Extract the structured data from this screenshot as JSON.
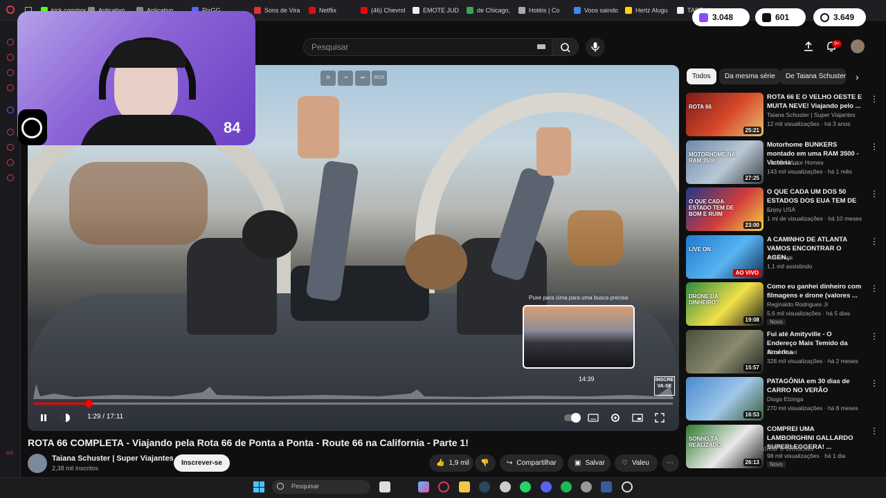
{
  "browser": {
    "bookmarks": [
      {
        "label": "kick.com/pog",
        "color": "#53fc18"
      },
      {
        "label": "Aplicativo",
        "color": "#888"
      },
      {
        "label": "Aplicativo",
        "color": "#888"
      },
      {
        "label": "PixGG",
        "color": "#5865f2"
      },
      {
        "label": "Sons de Vira",
        "color": "#d33"
      },
      {
        "label": "Netflix",
        "color": "#e50914"
      },
      {
        "label": "(46) Chevrol",
        "color": "#ff0000"
      },
      {
        "label": "EMOTE JUD",
        "color": "#eee"
      },
      {
        "label": "de Chicago,",
        "color": "#34a853"
      },
      {
        "label": "Hotéis | Co",
        "color": "#aaa"
      },
      {
        "label": "Voos saindo",
        "color": "#4285f4"
      },
      {
        "label": "Hertz Alugu",
        "color": "#ffd400"
      },
      {
        "label": "TABELA",
        "color": "#eee"
      }
    ]
  },
  "stream_overlay": {
    "score": "84",
    "stats": [
      {
        "value": "3.048",
        "icon": "twitch-viewers-icon",
        "color": "#9146ff"
      },
      {
        "value": "601",
        "icon": "kick-viewers-icon",
        "color": "#111"
      },
      {
        "value": "3.649",
        "icon": "globe-viewers-icon",
        "color": "#111"
      }
    ]
  },
  "header": {
    "search_placeholder": "Pesquisar",
    "notifications_badge": "9+"
  },
  "player": {
    "hint": "Puxe para cima para uma busca precisa",
    "preview_time": "14:39",
    "current_time": "1:29",
    "duration": "17:11",
    "time_display": "1:29 / 17:11",
    "progress_fraction": 0.0863,
    "hover_fraction": 0.852,
    "inscreva_label": "INSCRE VA-SE",
    "top_controls": [
      "copy-icon",
      "enter-icon",
      "skip-icon",
      "RGX"
    ]
  },
  "video": {
    "title": "ROTA 66 COMPLETA - Viajando pela Rota 66 de Ponta a Ponta - Route 66 na California - Parte 1!",
    "channel": "Taiana Schuster | Super Viajantes",
    "subscribers": "2,38 mil inscritos",
    "subscribe_label": "Inscrever-se",
    "likes": "1,9 mil",
    "share_label": "Compartilhar",
    "save_label": "Salvar",
    "thanks_label": "Valeu"
  },
  "chips": [
    "Todos",
    "Da mesma série",
    "De Taiana Schuster | Su"
  ],
  "recommendations": [
    {
      "title": "ROTA 66 E O VELHO OESTE E MUITA NEVE! Viajando pelo ...",
      "channel": "Taiana Schuster | Super Viajantes",
      "meta": "12 mil visualizações · há 3 anos",
      "duration": "25:21",
      "badge": "",
      "thumb_text": "ROTA 66",
      "colors": [
        "#7a1a1a",
        "#d84a2a",
        "#e8c070"
      ]
    },
    {
      "title": "Motorhome BUNKERS montado em uma RAM 3500 - Victória ...",
      "channel": "Victória Motor Homes",
      "meta": "143 mil visualizações · há 1 mês",
      "duration": "27:25",
      "badge": "",
      "thumb_text": "MOTORHOME NA RAM 3500",
      "colors": [
        "#6d8aa8",
        "#b9c8d5",
        "#3a3f46"
      ]
    },
    {
      "title": "O QUE CADA UM DOS 50 ESTADOS DOS EUA TEM DE ...",
      "channel": "Enjoy USA",
      "meta": "1 mi de visualizações · há 10 meses",
      "duration": "23:00",
      "badge": "",
      "thumb_text": "O QUE CADA ESTADO TEM DE BOM E RUIM",
      "colors": [
        "#1d3a8a",
        "#d23b3b",
        "#f2d24a"
      ]
    },
    {
      "title": "A CAMINHO DE ATLANTA VAMOS ENCONTRAR O AGEN...",
      "channel": "Jon Vlogs",
      "meta": "1,1 mil assistindo",
      "duration": "AO VIVO",
      "badge": "live",
      "thumb_text": "LIVE ON",
      "colors": [
        "#1f7ad1",
        "#58b3f0",
        "#0d2d52"
      ]
    },
    {
      "title": "Como eu ganhei dinheiro com filmagens e drone (valores ...",
      "channel": "Reginaldo Rodrigues Jr",
      "meta": "5,6 mil visualizações · há 5 dias",
      "duration": "19:08",
      "badge": "Novo",
      "thumb_text": "DRONE DÁ DINHEIRO?",
      "colors": [
        "#2b8a3e",
        "#f2e14a",
        "#1a1a1a"
      ]
    },
    {
      "title": "Fui até Amityville - O Endereço Mais Temido da América",
      "channel": "Elton Davel",
      "meta": "328 mil visualizações · há 2 meses",
      "duration": "15:57",
      "badge": "",
      "thumb_text": "",
      "colors": [
        "#4a4f3d",
        "#8a8a70",
        "#1f221c"
      ]
    },
    {
      "title": "PATAGÔNIA em 30 dias de CARRO NO VERÃO",
      "channel": "Diogo Elzinga",
      "meta": "270 mil visualizações · há 8 meses",
      "duration": "16:53",
      "badge": "",
      "thumb_text": "",
      "colors": [
        "#4a8ad0",
        "#9fc7e8",
        "#3d5a3a"
      ]
    },
    {
      "title": "COMPREI UMA LAMBORGHINI GALLARDO SUPERLEGGERA! ...",
      "channel": "Tecno Auto",
      "meta": "98 mil visualizações · há 1 dia",
      "duration": "26:13",
      "badge": "Novo",
      "thumb_text": "SONHO TÁ REALIZADO",
      "colors": [
        "#2f7a2f",
        "#eaeaea",
        "#1b1b1b"
      ]
    }
  ],
  "taskbar": {
    "search_placeholder": "Pesquisar"
  },
  "os_watermark": "Ativar o Windows"
}
